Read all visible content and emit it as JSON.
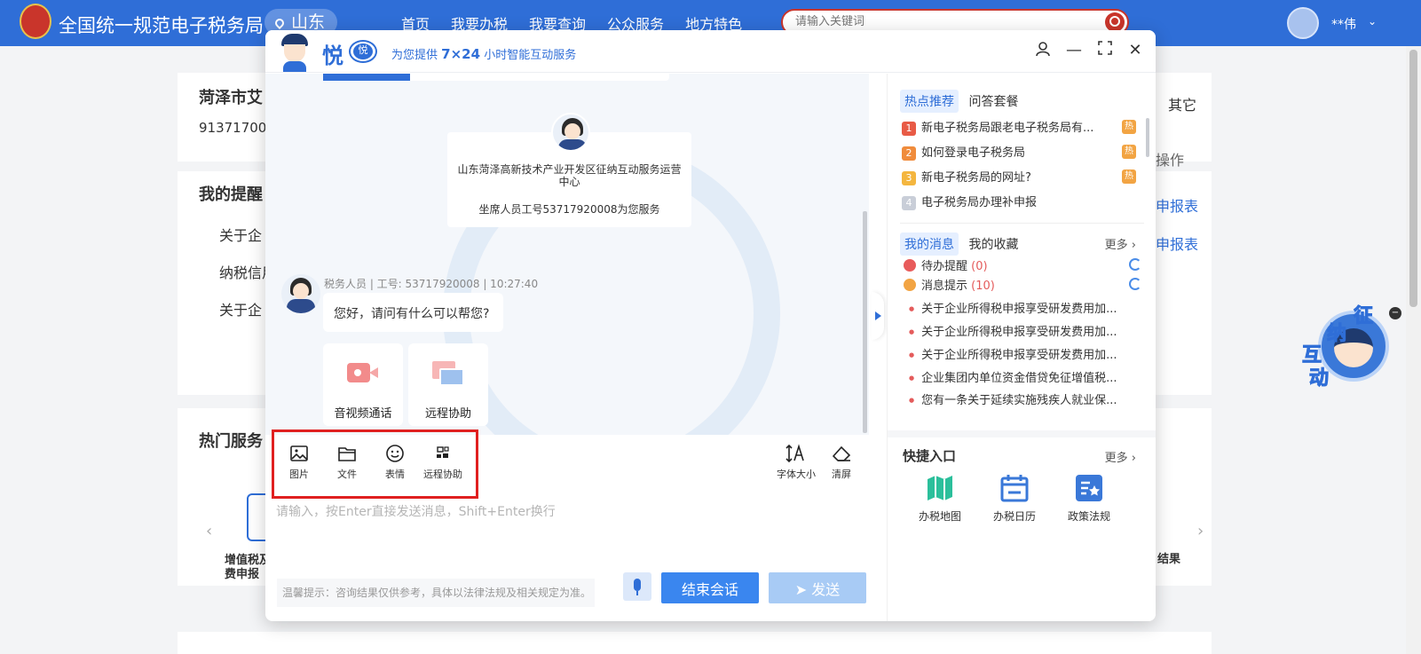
{
  "portal": {
    "title": "全国统一规范电子税务局",
    "region": "山东",
    "nav": [
      "首页",
      "我要办税",
      "我要查询",
      "公众服务",
      "地方特色"
    ],
    "search_placeholder": "请输入关键词",
    "user": "**伟",
    "company_name": "菏泽市艾",
    "company_id": "91371700",
    "tab_other": "其它",
    "op_label": "操作",
    "link1": "申报表",
    "link2": "申报表",
    "reminder_title": "我的提醒",
    "reminders": [
      "关于企",
      "纳税信用",
      "关于企"
    ],
    "hot_title": "热门服务",
    "service1": "增值税及",
    "service1b": "费申报",
    "result": "结果",
    "mascot_chars": [
      "征",
      "纳",
      "互",
      "动"
    ]
  },
  "dialog": {
    "brand": "悦",
    "brand_badge": "悦",
    "tagline_prefix": "为您提供",
    "tagline_bold": "7×24",
    "tagline_suffix": "小时智能互动服务",
    "center_org": "山东菏泽高新技术产业开发区征纳互动服务运营中心",
    "center_id": "坐席人员工号53717920008为您服务",
    "msg_meta": "税务人员 | 工号: 53717920008 | 10:27:40",
    "greeting": "您好，请问有什么可以帮您?",
    "service_cards": [
      "音视频通话",
      "远程协助"
    ],
    "tools": [
      "图片",
      "文件",
      "表情",
      "远程协助"
    ],
    "right_tools": [
      "字体大小",
      "清屏"
    ],
    "input_placeholder": "请输入，按Enter直接发送消息，Shift+Enter换行",
    "hint": "温馨提示：咨询结果仅供参考，具体以法律法规及相关规定为准。",
    "end_label": "结束会话",
    "send_label": "➤ 发送"
  },
  "right_panel": {
    "tabs": [
      "热点推荐",
      "问答套餐"
    ],
    "hot_items": [
      {
        "rank": "1",
        "text": "新电子税务局跟老电子税务局有...",
        "tag": "热",
        "color": "#e85b46"
      },
      {
        "rank": "2",
        "text": "如何登录电子税务局",
        "tag": "热",
        "color": "#f08c3c"
      },
      {
        "rank": "3",
        "text": "新电子税务局的网址?",
        "tag": "热",
        "color": "#f4b63f"
      },
      {
        "rank": "4",
        "text": "电子税务局办理补申报",
        "tag": "",
        "color": "#c9ced8"
      }
    ],
    "msg_tabs": [
      "我的消息",
      "我的收藏"
    ],
    "more": "更多",
    "pending_label": "待办提醒",
    "pending_count": "(0)",
    "notice_label": "消息提示",
    "notice_count": "(10)",
    "news": [
      "关于企业所得税申报享受研发费用加...",
      "关于企业所得税申报享受研发费用加...",
      "关于企业所得税申报享受研发费用加...",
      "企业集团内单位资金借贷免征增值税...",
      "您有一条关于延续实施残疾人就业保..."
    ],
    "quick_title": "快捷入口",
    "quick_more": "更多",
    "quick_items": [
      "办税地图",
      "办税日历",
      "政策法规"
    ]
  }
}
